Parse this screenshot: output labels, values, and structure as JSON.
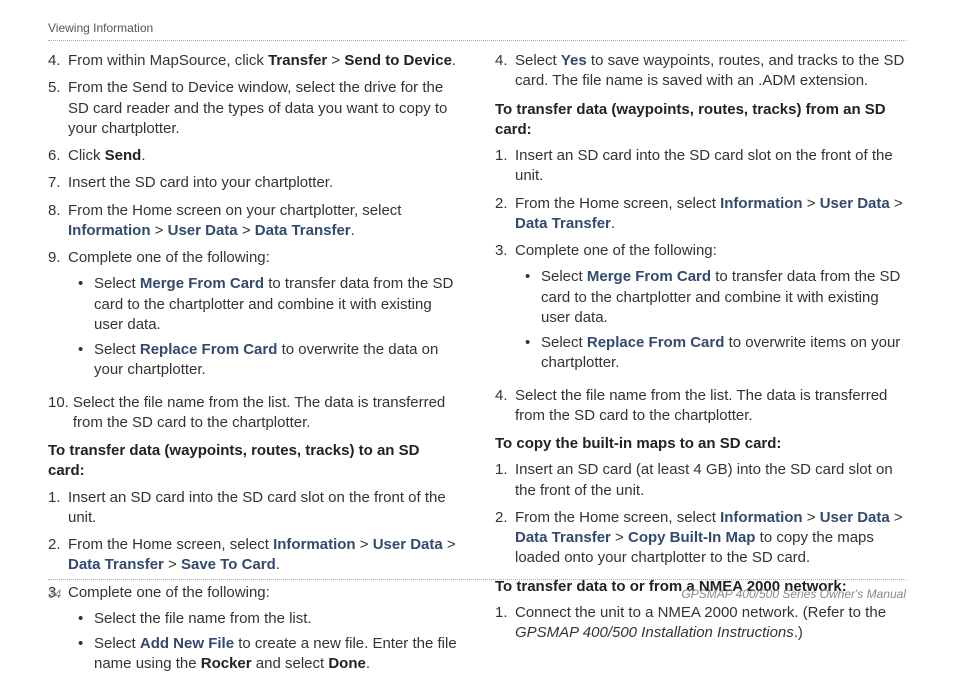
{
  "header": "Viewing Information",
  "left": {
    "list1": [
      {
        "n": "4.",
        "pre": "From within MapSource, click ",
        "b1": "Transfer",
        "sep1": " > ",
        "b2": "Send to Device",
        "post": "."
      },
      {
        "n": "5.",
        "text": "From the Send to Device window, select the drive for the SD card reader and the types of data you want to copy to your chartplotter."
      },
      {
        "n": "6.",
        "pre": "Click ",
        "b1": "Send",
        "post": "."
      },
      {
        "n": "7.",
        "text": "Insert the SD card into your chartplotter."
      },
      {
        "n": "8.",
        "pre": "From the Home screen on your chartplotter, select ",
        "l1": "Information",
        "sep1": " > ",
        "l2": "User Data",
        "sep2": " > ",
        "l3": "Data Transfer",
        "post": "."
      },
      {
        "n": "9.",
        "text": "Complete one of the following:",
        "sub": [
          {
            "pre": "Select ",
            "l1": "Merge From Card",
            "post": " to transfer data from the SD card to the chartplotter and combine it with existing user data."
          },
          {
            "pre": "Select ",
            "l1": "Replace From Card",
            "post": " to overwrite the data on your chartplotter."
          }
        ]
      },
      {
        "n": "10.",
        "text": "Select the file name from the list. The data is transferred from the SD card to the chartplotter."
      }
    ],
    "title2": "To transfer data (waypoints, routes, tracks) to an SD card:",
    "list2": [
      {
        "n": "1.",
        "text": "Insert an SD card into the SD card slot on the front of the unit."
      },
      {
        "n": "2.",
        "pre": "From the Home screen, select ",
        "l1": "Information",
        "sep1": " > ",
        "l2": "User Data",
        "sep2": " > ",
        "l3": "Data Transfer",
        "sep3": " > ",
        "l4": "Save To Card",
        "post": "."
      },
      {
        "n": "3.",
        "text": "Complete one of the following:",
        "sub": [
          {
            "text": "Select the file name from the list."
          },
          {
            "pre": "Select ",
            "l1": "Add New File",
            "mid": " to create a new file. Enter the file name using the ",
            "b1": "Rocker",
            "mid2": " and select ",
            "b2": "Done",
            "post": "."
          }
        ]
      }
    ]
  },
  "right": {
    "list0": [
      {
        "n": "4.",
        "pre": "Select ",
        "l1": "Yes",
        "post": " to save waypoints, routes, and tracks to the SD card. The file name is saved with an .ADM extension."
      }
    ],
    "title1": "To transfer data (waypoints, routes, tracks) from an SD card:",
    "list1": [
      {
        "n": "1.",
        "text": "Insert an SD card into the SD card slot on the front of the unit."
      },
      {
        "n": "2.",
        "pre": "From the Home screen, select ",
        "l1": "Information",
        "sep1": " > ",
        "l2": "User Data",
        "sep2": " > ",
        "l3": "Data Transfer",
        "post": "."
      },
      {
        "n": "3.",
        "text": "Complete one of the following:",
        "sub": [
          {
            "pre": "Select ",
            "l1": "Merge From Card",
            "post": " to transfer data from the SD card to the chartplotter and combine it with existing user data."
          },
          {
            "pre": "Select ",
            "l1": "Replace From Card",
            "post": " to overwrite items on your chartplotter."
          }
        ]
      },
      {
        "n": "4.",
        "text": "Select the file name from the list. The data is transferred from the SD card to the chartplotter."
      }
    ],
    "title2": "To copy the built-in maps to an SD card:",
    "list2": [
      {
        "n": "1.",
        "text": "Insert an SD card (at least 4 GB) into the SD card slot on the front of the unit."
      },
      {
        "n": "2.",
        "pre": "From the Home screen, select ",
        "l1": "Information",
        "sep1": " > ",
        "l2": "User Data",
        "sep2": " > ",
        "l3": "Data Transfer",
        "sep3": " > ",
        "l4": "Copy Built-In Map",
        "post": " to copy the maps loaded onto your chartplotter to the SD card."
      }
    ],
    "title3": "To transfer data to or from a NMEA 2000 network:",
    "list3": [
      {
        "n": "1.",
        "pre": "Connect the unit to a NMEA 2000 network. (Refer to the ",
        "i1": "GPSMAP 400/500 Installation Instructions",
        "post": ".)"
      }
    ]
  },
  "footer": {
    "page": "34",
    "doc": "GPSMAP 400/500 Series Owner's Manual"
  }
}
